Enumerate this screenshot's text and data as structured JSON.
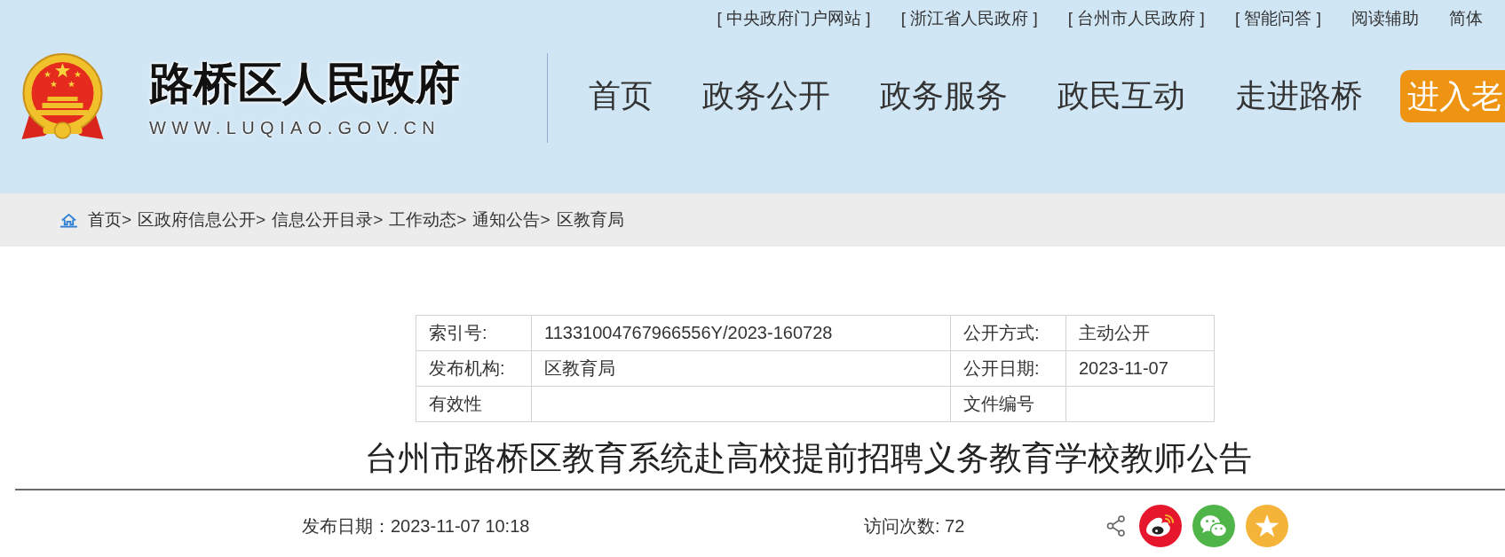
{
  "top_links": [
    "[ 中央政府门户网站 ]",
    "[ 浙江省人民政府 ]",
    "[ 台州市人民政府 ]",
    "[ 智能问答 ]",
    "阅读辅助",
    "简体"
  ],
  "site": {
    "title": "路桥区人民政府",
    "url": "WWW.LUQIAO.GOV.CN"
  },
  "nav": {
    "items": [
      {
        "label": "首页",
        "selected": false
      },
      {
        "label": "政务公开",
        "selected": false
      },
      {
        "label": "政务服务",
        "selected": false
      },
      {
        "label": "政民互动",
        "selected": false
      },
      {
        "label": "走进路桥",
        "selected": false
      }
    ],
    "elder_button": "进入老"
  },
  "breadcrumb": [
    {
      "label": "首页",
      "separator": ">"
    },
    {
      "label": "区政府信息公开",
      "separator": ">"
    },
    {
      "label": "信息公开目录",
      "separator": ">"
    },
    {
      "label": "工作动态",
      "separator": ">"
    },
    {
      "label": "通知公告",
      "separator": ">"
    },
    {
      "label": "区教育局"
    }
  ],
  "info_table": {
    "rows": [
      {
        "pairs": [
          {
            "label": "索引号:",
            "value": "11331004767966556Y/2023-160728"
          },
          {
            "label": "公开方式:",
            "value": "主动公开"
          }
        ]
      },
      {
        "pairs": [
          {
            "label": "发布机构:",
            "value": "区教育局"
          },
          {
            "label": "公开日期:",
            "value": "2023-11-07"
          }
        ]
      },
      {
        "pairs": [
          {
            "label": "有效性"
          },
          {
            "label": "文件编号"
          }
        ]
      }
    ]
  },
  "article": {
    "title": "台州市路桥区教育系统赴高校提前招聘义务教育学校教师公告",
    "published": "发布日期：2023-11-07 10:18",
    "visits": "访问次数: 72",
    "share": [
      {
        "kind": "share"
      },
      {
        "kind": "weibo"
      },
      {
        "kind": "wechat"
      },
      {
        "kind": "qzone"
      }
    ]
  }
}
